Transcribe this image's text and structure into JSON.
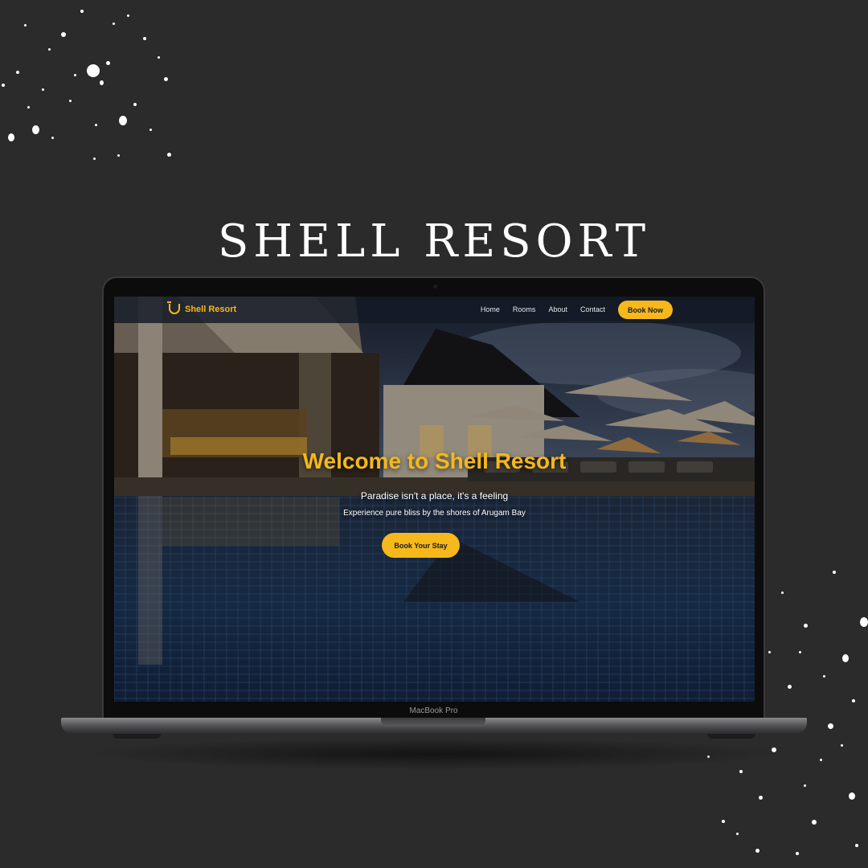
{
  "poster": {
    "headline": "SHELL RESORT"
  },
  "device": {
    "label": "MacBook Pro"
  },
  "site": {
    "brand": "Shell Resort",
    "nav": [
      "Home",
      "Rooms",
      "About",
      "Contact"
    ],
    "nav_cta": "Book Now",
    "hero": {
      "title": "Welcome to Shell Resort",
      "subtitle": "Paradise isn't a place, it's a feeling",
      "description": "Experience pure bliss by the shores of Arugam Bay",
      "cta": "Book Your Stay"
    },
    "colors": {
      "accent": "#f7b81c",
      "page_bg": "#2b2b2b",
      "nav_bg": "#141a26"
    }
  }
}
